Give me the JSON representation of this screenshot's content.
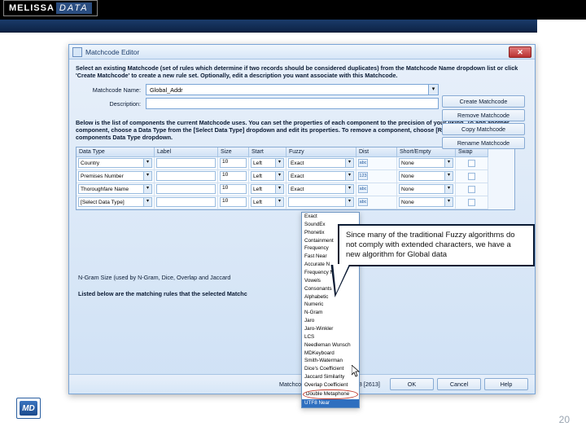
{
  "brand": {
    "name1": "MELISSA",
    "name2": "DATA",
    "badge": "MD"
  },
  "page_number": "20",
  "dialog": {
    "title": "Matchcode Editor",
    "close": "✕",
    "intro": "Select an existing Matchcode (set of rules which determine if two records should be considered duplicates) from the Matchcode Name dropdown list or click 'Create Matchcode' to create a new rule set. Optionally, edit a description you want associate with this Matchcode.",
    "name_label": "Matchcode Name:",
    "name_value": "Global_Addr",
    "desc_label": "Description:",
    "buttons": {
      "create": "Create Matchcode",
      "remove": "Remove Matchcode",
      "copy": "Copy Matchcode",
      "rename": "Rename Matchcode"
    },
    "components_text": "Below is the list of components the current Matchcode uses. You can set the properties of each component to the precision of your liking. To add another component, choose a Data Type from the [Select Data Type] dropdown and edit its properties. To remove a component, choose [Remove Component] from that components Data Type dropdown.",
    "columns": [
      "Data Type",
      "Label",
      "Size",
      "Start",
      "Fuzzy",
      "Dist",
      "Short/Empty",
      "Swap"
    ],
    "rows": [
      {
        "dt": "Country",
        "label": "",
        "size": "10",
        "start": "Left",
        "fuzzy": "Exact",
        "dist": "",
        "se": "None",
        "swap": false,
        "icon": "abc"
      },
      {
        "dt": "Premises Number",
        "label": "",
        "size": "10",
        "start": "Left",
        "fuzzy": "Exact",
        "dist": "",
        "se": "None",
        "swap": false,
        "icon": "123"
      },
      {
        "dt": "Thoroughfare Name",
        "label": "",
        "size": "10",
        "start": "Left",
        "fuzzy": "Exact",
        "dist": "",
        "se": "None",
        "swap": false,
        "icon": "abc"
      },
      {
        "dt": "[Select Data Type]",
        "label": "",
        "size": "10",
        "start": "Left",
        "fuzzy": "",
        "dist": "",
        "se": "None",
        "swap": false,
        "icon": "abc"
      }
    ],
    "fuzzy_options": [
      "Exact",
      "SoundEx",
      "Phonetix",
      "Containment",
      "Frequency",
      "Fast Near",
      "Accurate N",
      "Frequency N",
      "Vowels",
      "Consonants",
      "Alphabetic",
      "Numeric",
      "N-Gram",
      "Jaro",
      "Jaro-Winkler",
      "LCS",
      "Needleman Wunsch",
      "MDKeyboard",
      "Smith-Waterman",
      "Dice's Coefficient",
      "Jaccard Similarity",
      "Overlap Coefficient",
      "Double Metaphone",
      "UTF8 Near"
    ],
    "fuzzy_circled": "Double Metaphone",
    "fuzzy_highlight": "UTF8 Near",
    "ngram_label": "N-Gram Size (used by N-Gram, Dice, Overlap and Jaccard",
    "matching_label": "Listed below are the matching rules that the selected Matchc",
    "footer": {
      "version": "Matchcode Editor Version: 2908 [2613]",
      "ok": "OK",
      "cancel": "Cancel",
      "help": "Help"
    }
  },
  "callout": "Since many of the traditional Fuzzy algorithms do not comply with extended characters, we have  a new algorithm for Global data"
}
